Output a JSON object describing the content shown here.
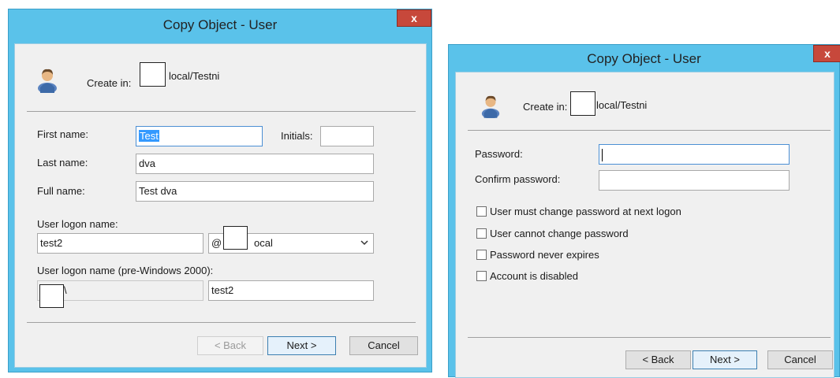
{
  "left_dialog": {
    "title": "Copy Object - User",
    "close_label": "x",
    "create_in_label": "Create in:",
    "create_in_value": "local/Testni",
    "first_name_label": "First name:",
    "first_name_value": "Test",
    "initials_label": "Initials:",
    "initials_value": "",
    "last_name_label": "Last name:",
    "last_name_value": "dva",
    "full_name_label": "Full name:",
    "full_name_value": "Test dva",
    "logon_name_label": "User logon name:",
    "logon_name_value": "test2",
    "domain_at": "@",
    "domain_suffix": "ocal",
    "pre2000_label": "User logon name (pre-Windows 2000):",
    "pre2000_domain_suffix": "\\",
    "pre2000_value": "test2",
    "buttons": {
      "back": "< Back",
      "next": "Next >",
      "cancel": "Cancel"
    }
  },
  "right_dialog": {
    "title": "Copy Object - User",
    "close_label": "x",
    "create_in_label": "Create in:",
    "create_in_value": "local/Testni",
    "password_label": "Password:",
    "password_value": "",
    "confirm_label": "Confirm password:",
    "confirm_value": "",
    "checkboxes": [
      "User must change password at next logon",
      "User cannot change password",
      "Password never expires",
      "Account is disabled"
    ],
    "buttons": {
      "back": "< Back",
      "next": "Next >",
      "cancel": "Cancel"
    }
  },
  "colors": {
    "title_bar": "#5ac2ea",
    "close_button": "#c7483b",
    "client_bg": "#f0f0f0",
    "selection": "#3399ff"
  }
}
